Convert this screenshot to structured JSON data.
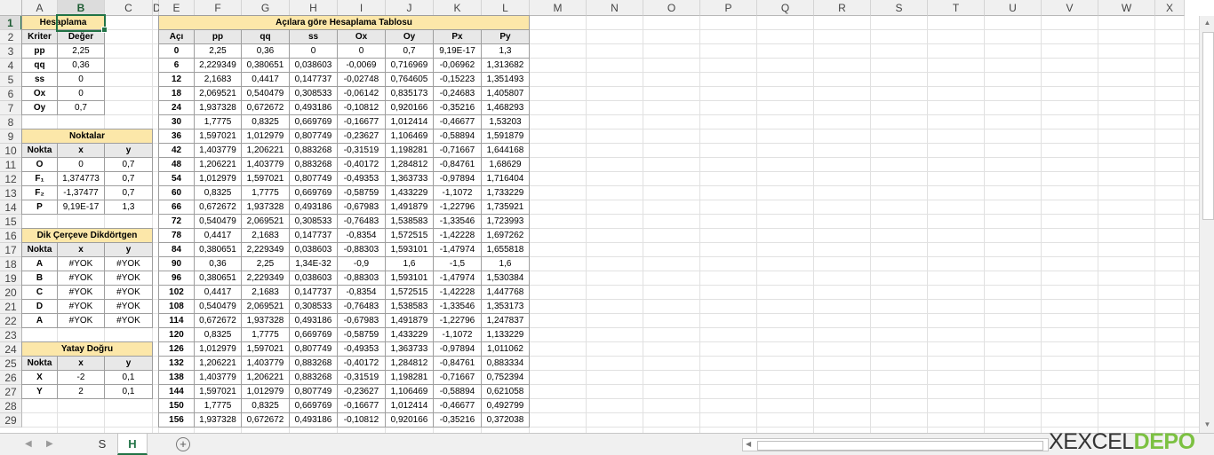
{
  "columns": [
    "A",
    "B",
    "C",
    "D",
    "E",
    "F",
    "G",
    "H",
    "I",
    "J",
    "K",
    "L",
    "M",
    "N",
    "O",
    "P",
    "Q",
    "R",
    "S",
    "T",
    "U",
    "V",
    "W",
    "X"
  ],
  "rows": [
    "1",
    "2",
    "3",
    "4",
    "5",
    "6",
    "7",
    "8",
    "9",
    "10",
    "11",
    "12",
    "13",
    "14",
    "15",
    "16",
    "17",
    "18",
    "19",
    "20",
    "21",
    "22",
    "23",
    "24",
    "25",
    "26",
    "27",
    "28",
    "29"
  ],
  "hesaplama": {
    "title": "Hesaplama",
    "headers": [
      "Kriter",
      "Değer"
    ],
    "rows": [
      [
        "pp",
        "2,25"
      ],
      [
        "qq",
        "0,36"
      ],
      [
        "ss",
        "0"
      ],
      [
        "Ox",
        "0"
      ],
      [
        "Oy",
        "0,7"
      ]
    ]
  },
  "noktalar": {
    "title": "Noktalar",
    "headers": [
      "Nokta",
      "x",
      "y"
    ],
    "rows": [
      [
        "O",
        "0",
        "0,7"
      ],
      [
        "F₁",
        "1,374773",
        "0,7"
      ],
      [
        "F₂",
        "-1,37477",
        "0,7"
      ],
      [
        "P",
        "9,19E-17",
        "1,3"
      ]
    ]
  },
  "cerceve": {
    "title": "Dik Çerçeve Dikdörtgen",
    "headers": [
      "Nokta",
      "x",
      "y"
    ],
    "rows": [
      [
        "A",
        "#YOK",
        "#YOK"
      ],
      [
        "B",
        "#YOK",
        "#YOK"
      ],
      [
        "C",
        "#YOK",
        "#YOK"
      ],
      [
        "D",
        "#YOK",
        "#YOK"
      ],
      [
        "A",
        "#YOK",
        "#YOK"
      ]
    ]
  },
  "yatay": {
    "title": "Yatay Doğru",
    "headers": [
      "Nokta",
      "x",
      "y"
    ],
    "rows": [
      [
        "X",
        "-2",
        "0,1"
      ],
      [
        "Y",
        "2",
        "0,1"
      ]
    ]
  },
  "aci_table": {
    "title": "Açılara göre Hesaplama Tablosu",
    "headers": [
      "Açı",
      "pp",
      "qq",
      "ss",
      "Ox",
      "Oy",
      "Px",
      "Py"
    ],
    "rows": [
      [
        "0",
        "2,25",
        "0,36",
        "0",
        "0",
        "0,7",
        "9,19E-17",
        "1,3"
      ],
      [
        "6",
        "2,229349",
        "0,380651",
        "0,038603",
        "-0,0069",
        "0,716969",
        "-0,06962",
        "1,313682"
      ],
      [
        "12",
        "2,1683",
        "0,4417",
        "0,147737",
        "-0,02748",
        "0,764605",
        "-0,15223",
        "1,351493"
      ],
      [
        "18",
        "2,069521",
        "0,540479",
        "0,308533",
        "-0,06142",
        "0,835173",
        "-0,24683",
        "1,405807"
      ],
      [
        "24",
        "1,937328",
        "0,672672",
        "0,493186",
        "-0,10812",
        "0,920166",
        "-0,35216",
        "1,468293"
      ],
      [
        "30",
        "1,7775",
        "0,8325",
        "0,669769",
        "-0,16677",
        "1,012414",
        "-0,46677",
        "1,53203"
      ],
      [
        "36",
        "1,597021",
        "1,012979",
        "0,807749",
        "-0,23627",
        "1,106469",
        "-0,58894",
        "1,591879"
      ],
      [
        "42",
        "1,403779",
        "1,206221",
        "0,883268",
        "-0,31519",
        "1,198281",
        "-0,71667",
        "1,644168"
      ],
      [
        "48",
        "1,206221",
        "1,403779",
        "0,883268",
        "-0,40172",
        "1,284812",
        "-0,84761",
        "1,68629"
      ],
      [
        "54",
        "1,012979",
        "1,597021",
        "0,807749",
        "-0,49353",
        "1,363733",
        "-0,97894",
        "1,716404"
      ],
      [
        "60",
        "0,8325",
        "1,7775",
        "0,669769",
        "-0,58759",
        "1,433229",
        "-1,1072",
        "1,733229"
      ],
      [
        "66",
        "0,672672",
        "1,937328",
        "0,493186",
        "-0,67983",
        "1,491879",
        "-1,22796",
        "1,735921"
      ],
      [
        "72",
        "0,540479",
        "2,069521",
        "0,308533",
        "-0,76483",
        "1,538583",
        "-1,33546",
        "1,723993"
      ],
      [
        "78",
        "0,4417",
        "2,1683",
        "0,147737",
        "-0,8354",
        "1,572515",
        "-1,42228",
        "1,697262"
      ],
      [
        "84",
        "0,380651",
        "2,229349",
        "0,038603",
        "-0,88303",
        "1,593101",
        "-1,47974",
        "1,655818"
      ],
      [
        "90",
        "0,36",
        "2,25",
        "1,34E-32",
        "-0,9",
        "1,6",
        "-1,5",
        "1,6"
      ],
      [
        "96",
        "0,380651",
        "2,229349",
        "0,038603",
        "-0,88303",
        "1,593101",
        "-1,47974",
        "1,530384"
      ],
      [
        "102",
        "0,4417",
        "2,1683",
        "0,147737",
        "-0,8354",
        "1,572515",
        "-1,42228",
        "1,447768"
      ],
      [
        "108",
        "0,540479",
        "2,069521",
        "0,308533",
        "-0,76483",
        "1,538583",
        "-1,33546",
        "1,353173"
      ],
      [
        "114",
        "0,672672",
        "1,937328",
        "0,493186",
        "-0,67983",
        "1,491879",
        "-1,22796",
        "1,247837"
      ],
      [
        "120",
        "0,8325",
        "1,7775",
        "0,669769",
        "-0,58759",
        "1,433229",
        "-1,1072",
        "1,133229"
      ],
      [
        "126",
        "1,012979",
        "1,597021",
        "0,807749",
        "-0,49353",
        "1,363733",
        "-0,97894",
        "1,011062"
      ],
      [
        "132",
        "1,206221",
        "1,403779",
        "0,883268",
        "-0,40172",
        "1,284812",
        "-0,84761",
        "0,883334"
      ],
      [
        "138",
        "1,403779",
        "1,206221",
        "0,883268",
        "-0,31519",
        "1,198281",
        "-0,71667",
        "0,752394"
      ],
      [
        "144",
        "1,597021",
        "1,012979",
        "0,807749",
        "-0,23627",
        "1,106469",
        "-0,58894",
        "0,621058"
      ],
      [
        "150",
        "1,7775",
        "0,8325",
        "0,669769",
        "-0,16677",
        "1,012414",
        "-0,46677",
        "0,492799"
      ],
      [
        "156",
        "1,937328",
        "0,672672",
        "0,493186",
        "-0,10812",
        "0,920166",
        "-0,35216",
        "0,372038"
      ]
    ]
  },
  "sheet_tabs": [
    "S",
    "H"
  ],
  "active_tab": "H",
  "add_sheet_icon": "plus-circle-icon",
  "logo": {
    "part1": "EXCEL",
    "part2": "DEPO",
    "color1": "#333333",
    "color2": "#7cc142"
  },
  "accent_color": "#217346"
}
